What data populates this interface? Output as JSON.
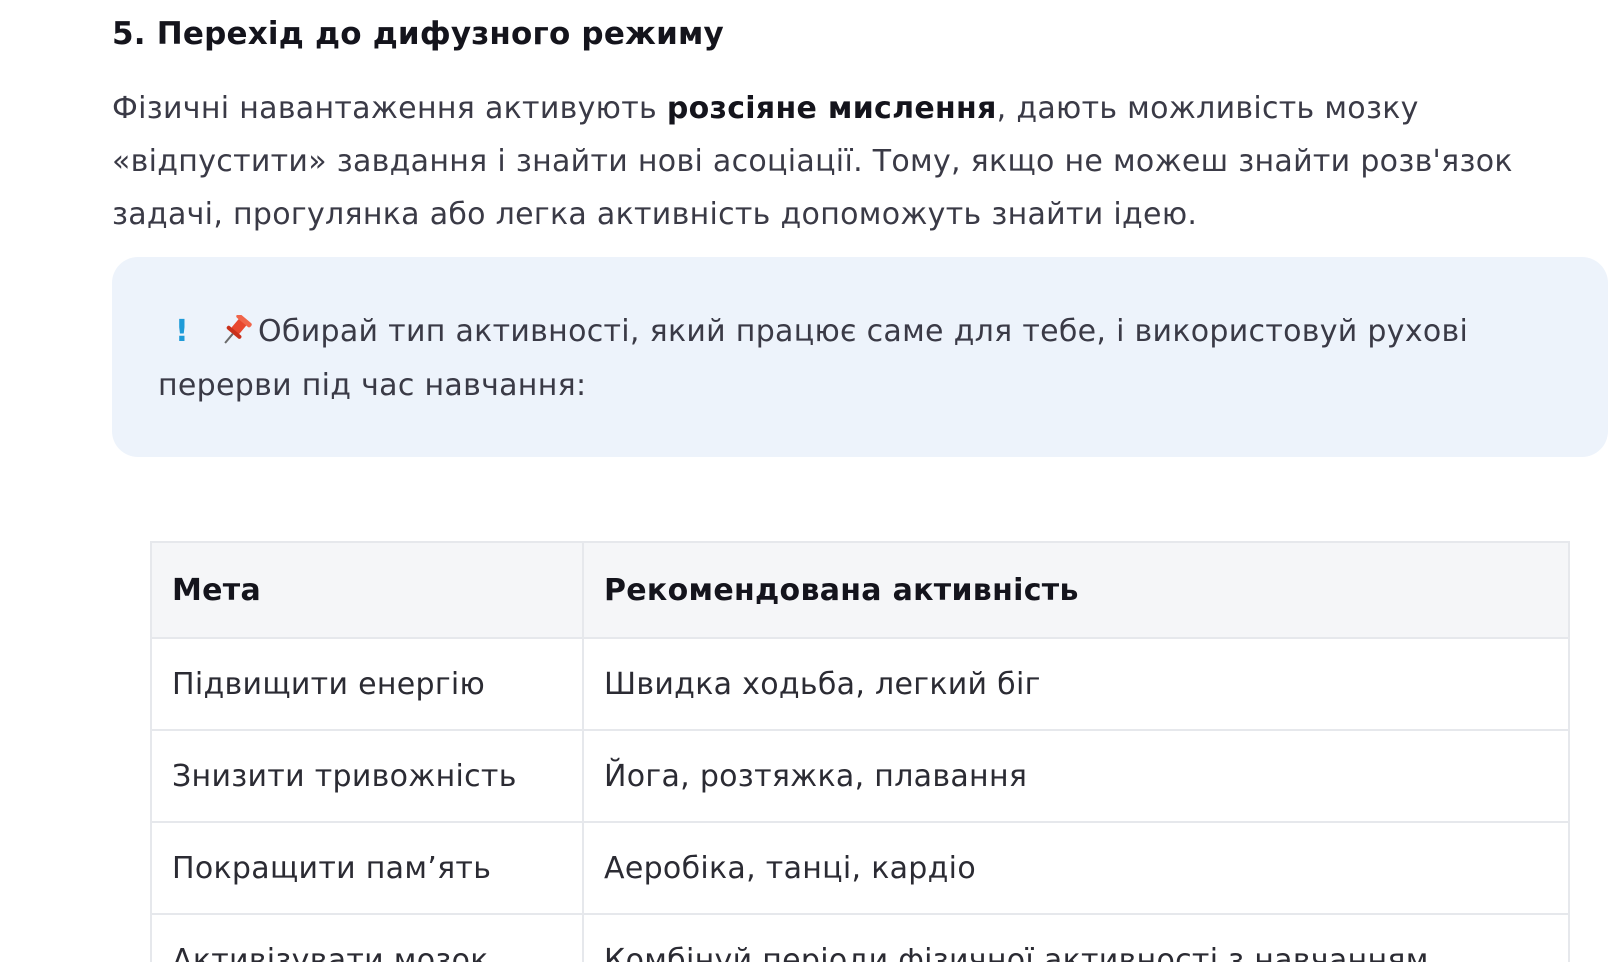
{
  "section": {
    "heading": "5. Перехід до дифузного режиму",
    "paragraph": {
      "before": "Фізичні навантаження активують ",
      "bold": "розсіяне мислення",
      "after": ", дають можливість мозку «відпустити» завдання і знайти нові асоціації. Тому, якщо не можеш знайти розв'язок задачі, прогулянка або легка активність допоможуть знайти ідею."
    }
  },
  "callout": {
    "exclamation": "!",
    "pin_icon": "pushpin-icon",
    "text": "Обирай тип активності, який працює саме для тебе, і використовуй рухові перерви під час навчання:",
    "background": "#edf3fb",
    "accent": "#1f9bd8"
  },
  "table": {
    "headers": [
      "Мета",
      "Рекомендована активність"
    ],
    "rows": [
      [
        "Підвищити енергію",
        "Швидка ходьба, легкий біг"
      ],
      [
        "Знизити тривожність",
        "Йога, розтяжка, плавання"
      ],
      [
        "Покращити пам’ять",
        "Аеробіка, танці, кардіо"
      ],
      [
        "Активізувати мозок",
        "Комбінуй періоди фізичної активності з навчанням"
      ]
    ]
  }
}
